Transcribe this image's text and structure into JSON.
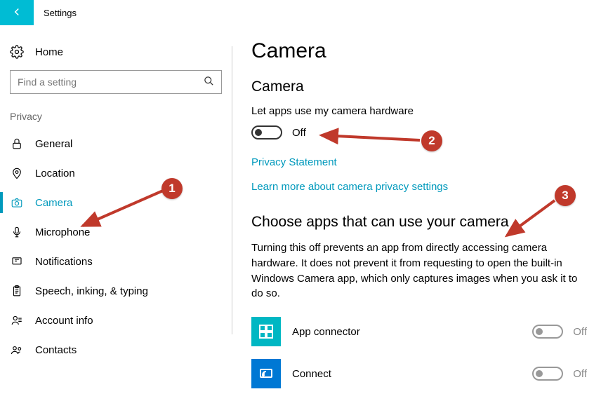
{
  "titlebar": {
    "label": "Settings"
  },
  "sidebar": {
    "home_label": "Home",
    "search_placeholder": "Find a setting",
    "section_label": "Privacy",
    "items": [
      {
        "label": "General"
      },
      {
        "label": "Location"
      },
      {
        "label": "Camera"
      },
      {
        "label": "Microphone"
      },
      {
        "label": "Notifications"
      },
      {
        "label": "Speech, inking, & typing"
      },
      {
        "label": "Account info"
      },
      {
        "label": "Contacts"
      }
    ],
    "active_index": 2
  },
  "main": {
    "page_title": "Camera",
    "section1": {
      "heading": "Camera",
      "field_label": "Let apps use my camera hardware",
      "toggle_state": "Off",
      "link_privacy": "Privacy Statement",
      "link_learn": "Learn more about camera privacy settings"
    },
    "section2": {
      "heading": "Choose apps that can use your camera",
      "body": "Turning this off prevents an app from directly accessing camera hardware. It does not prevent it from requesting to open the built-in Windows Camera app, which only captures images when you ask it to do so.",
      "apps": [
        {
          "name": "App connector",
          "state": "Off"
        },
        {
          "name": "Connect",
          "state": "Off"
        }
      ]
    }
  },
  "annotations": {
    "b1": "1",
    "b2": "2",
    "b3": "3"
  }
}
